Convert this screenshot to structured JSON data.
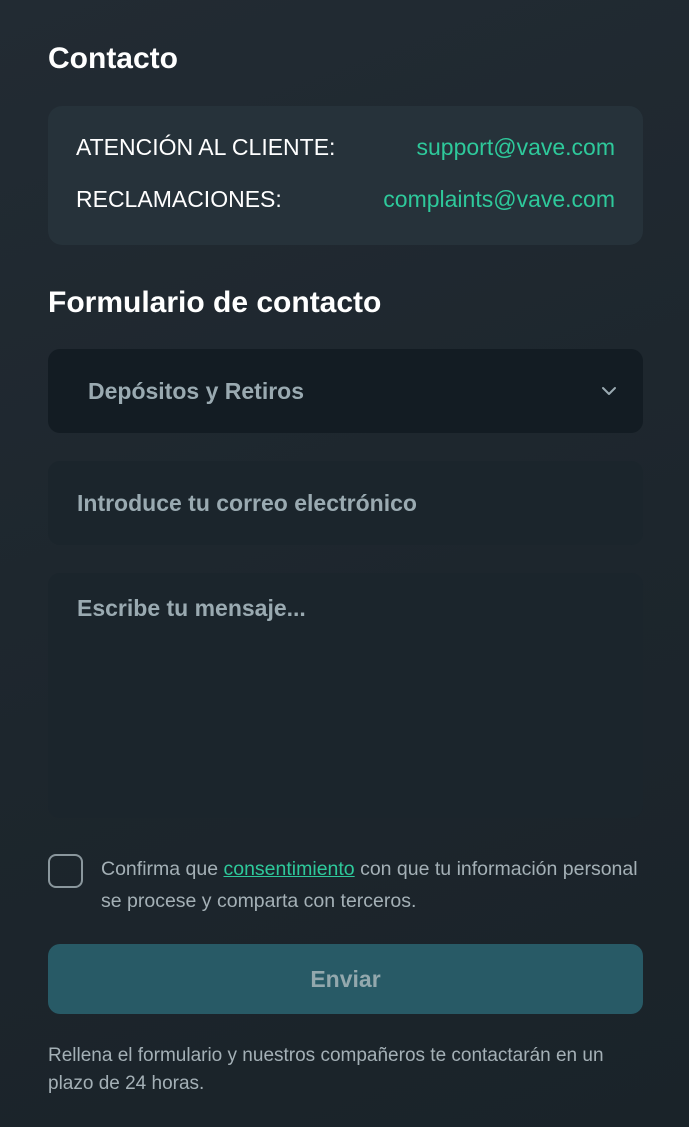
{
  "contact": {
    "title": "Contacto",
    "rows": [
      {
        "label": "ATENCIÓN AL CLIENTE:",
        "email": "support@vave.com"
      },
      {
        "label": "RECLAMACIONES:",
        "email": "complaints@vave.com"
      }
    ]
  },
  "form": {
    "title": "Formulario de contacto",
    "topic_selected": "Depósitos y Retiros",
    "email_placeholder": "Introduce tu correo electrónico",
    "message_placeholder": "Escribe tu mensaje...",
    "consent_prefix": "Confirma que",
    "consent_link": "consentimiento",
    "consent_suffix": "con que tu información personal se procese y comparta con terceros.",
    "submit_label": "Enviar",
    "footnote": "Rellena el formulario y nuestros compañeros te contactarán en un plazo de 24 horas."
  },
  "icons": {
    "select": "chevron-down-icon",
    "consent": "checkbox"
  },
  "colors": {
    "accent": "#2ec99b",
    "background": "#1e272e",
    "card": "#26323a",
    "field": "#1b252c",
    "select": "#131c23",
    "button": "#285a66"
  }
}
